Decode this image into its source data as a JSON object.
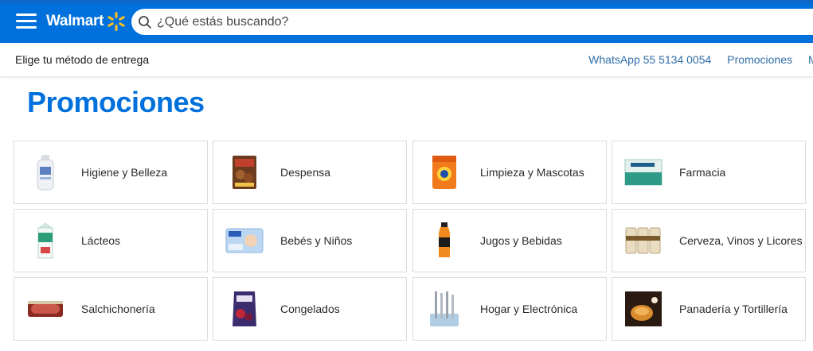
{
  "header": {
    "brand": "Walmart",
    "brand_color": "#0071dc",
    "spark_color": "#ffc220",
    "search_placeholder": "¿Qué estás buscando?"
  },
  "subbar": {
    "delivery_label": "Elige tu método de entrega",
    "links": [
      "WhatsApp 55 5134 0054",
      "Promociones",
      "M"
    ]
  },
  "page": {
    "title": "Promociones"
  },
  "categories": [
    {
      "label": "Higiene y Belleza",
      "icon": "shampoo-bottle-icon"
    },
    {
      "label": "Despensa",
      "icon": "cereal-box-icon"
    },
    {
      "label": "Limpieza y Mascotas",
      "icon": "detergent-icon"
    },
    {
      "label": "Farmacia",
      "icon": "medicine-box-icon"
    },
    {
      "label": "Lácteos",
      "icon": "milk-carton-icon"
    },
    {
      "label": "Bebés y Niños",
      "icon": "diapers-pack-icon"
    },
    {
      "label": "Jugos y Bebidas",
      "icon": "drink-bottle-icon"
    },
    {
      "label": "Cerveza, Vinos y Licores",
      "icon": "beer-cans-icon"
    },
    {
      "label": "Salchichonería",
      "icon": "sausage-pack-icon"
    },
    {
      "label": "Congelados",
      "icon": "frozen-bag-icon"
    },
    {
      "label": "Hogar y Electrónica",
      "icon": "cutlery-set-icon"
    },
    {
      "label": "Panadería y Tortillería",
      "icon": "bread-icon"
    }
  ]
}
